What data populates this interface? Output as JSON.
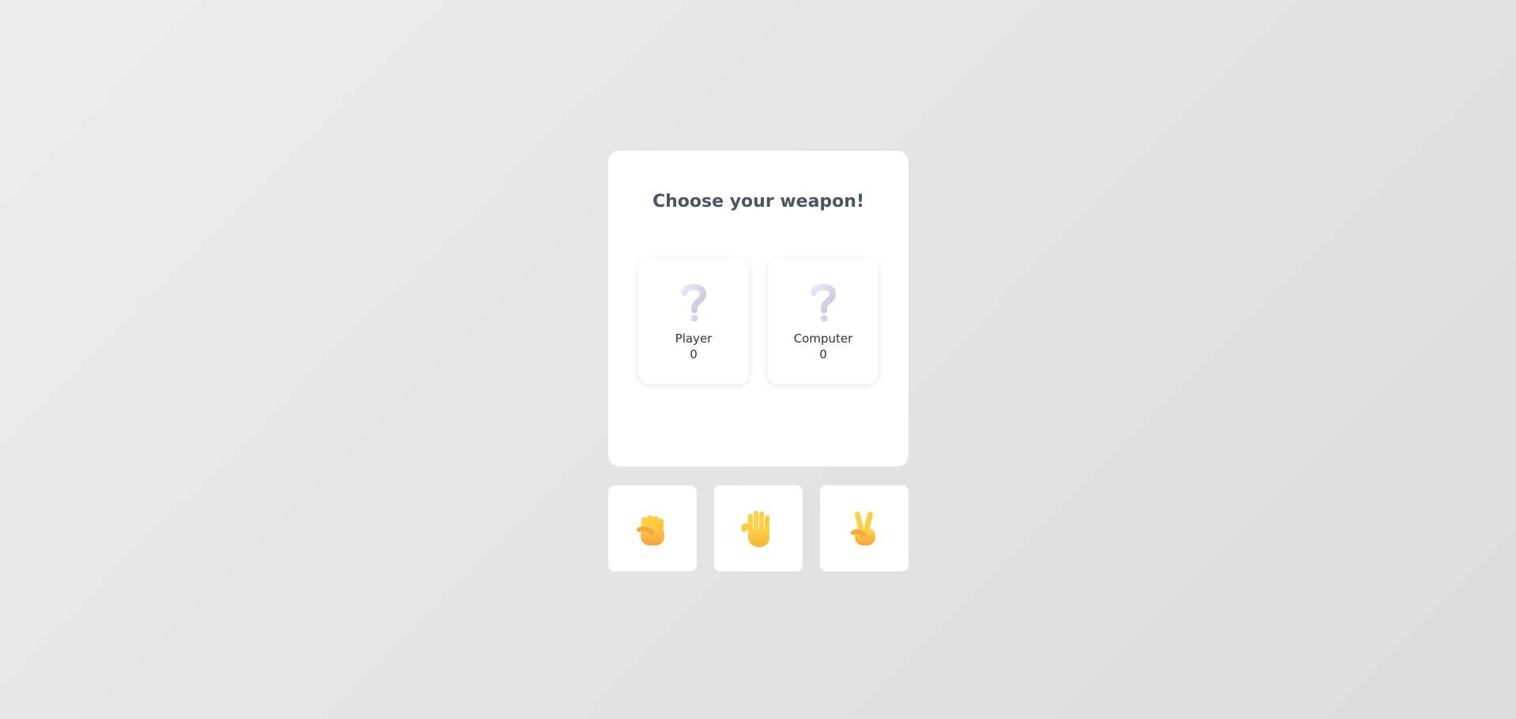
{
  "title": "Choose your weapon!",
  "player": {
    "label": "Player",
    "score": "0",
    "choice_icon": "question-mark-icon"
  },
  "computer": {
    "label": "Computer",
    "score": "0",
    "choice_icon": "question-mark-icon"
  },
  "weapons": [
    {
      "name": "rock",
      "icon": "raised-fist-icon"
    },
    {
      "name": "paper",
      "icon": "raised-hand-icon"
    },
    {
      "name": "scissors",
      "icon": "victory-hand-icon"
    }
  ],
  "colors": {
    "title": "#4a5568",
    "question_mark": "#d4cde6",
    "hand": "#ffc83d",
    "card": "#ffffff"
  }
}
